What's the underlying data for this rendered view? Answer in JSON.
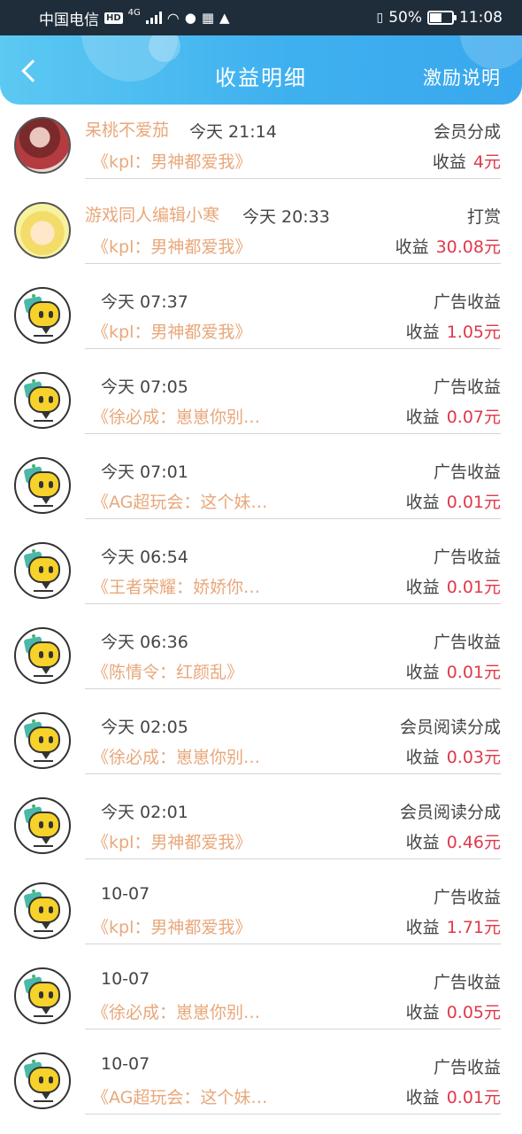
{
  "status_bar": {
    "carrier": "中国电信",
    "hd": "HD",
    "network": "4G",
    "battery": "50%",
    "time": "11:08"
  },
  "header": {
    "title": "收益明细",
    "right_action": "激励说明"
  },
  "earning_label": "收益",
  "records": [
    {
      "avatar": "photo",
      "nickname": "呆桃不爱茄",
      "time": "今天 21:14",
      "type": "会员分成",
      "work": "《kpl：男神都爱我》",
      "amount": "4元"
    },
    {
      "avatar": "cartoon",
      "nickname": "游戏同人编辑小寒",
      "time": "今天 20:33",
      "type": "打赏",
      "work": "《kpl：男神都爱我》",
      "amount": "30.08元"
    },
    {
      "avatar": "default",
      "nickname": "",
      "time": "今天 07:37",
      "type": "广告收益",
      "work": "《kpl：男神都爱我》",
      "amount": "1.05元"
    },
    {
      "avatar": "default",
      "nickname": "",
      "time": "今天 07:05",
      "type": "广告收益",
      "work": "《徐必成：崽崽你别…",
      "amount": "0.07元"
    },
    {
      "avatar": "default",
      "nickname": "",
      "time": "今天 07:01",
      "type": "广告收益",
      "work": "《AG超玩会：这个妹…",
      "amount": "0.01元"
    },
    {
      "avatar": "default",
      "nickname": "",
      "time": "今天 06:54",
      "type": "广告收益",
      "work": "《王者荣耀：娇娇你…",
      "amount": "0.01元"
    },
    {
      "avatar": "default",
      "nickname": "",
      "time": "今天 06:36",
      "type": "广告收益",
      "work": "《陈情令：红颜乱》",
      "amount": "0.01元"
    },
    {
      "avatar": "default",
      "nickname": "",
      "time": "今天 02:05",
      "type": "会员阅读分成",
      "work": "《徐必成：崽崽你别…",
      "amount": "0.03元"
    },
    {
      "avatar": "default",
      "nickname": "",
      "time": "今天 02:01",
      "type": "会员阅读分成",
      "work": "《kpl：男神都爱我》",
      "amount": "0.46元"
    },
    {
      "avatar": "default",
      "nickname": "",
      "time": "10-07",
      "type": "广告收益",
      "work": "《kpl：男神都爱我》",
      "amount": "1.71元"
    },
    {
      "avatar": "default",
      "nickname": "",
      "time": "10-07",
      "type": "广告收益",
      "work": "《徐必成：崽崽你别…",
      "amount": "0.05元"
    },
    {
      "avatar": "default",
      "nickname": "",
      "time": "10-07",
      "type": "广告收益",
      "work": "《AG超玩会：这个妹…",
      "amount": "0.01元"
    }
  ]
}
